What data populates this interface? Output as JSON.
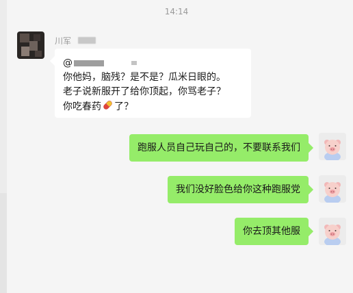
{
  "chat": {
    "timestamp": "14:14",
    "incoming": {
      "sender_name": "川军",
      "mention_prefix": "@",
      "lines": [
        "你他妈，脑残？是不是？瓜米日眼的。",
        "老子说新服开了给你顶起，你骂老子？",
        "你吃春药",
        "了？"
      ],
      "emoji": "pill-icon"
    },
    "outgoing": [
      {
        "text": "跑服人员自己玩自己的，不要联系我们"
      },
      {
        "text": "我们没好脸色给你这种跑服党"
      },
      {
        "text": "你去顶其他服"
      }
    ]
  },
  "colors": {
    "background": "#f5f5f5",
    "incoming_bubble": "#ffffff",
    "outgoing_bubble": "#95ec69",
    "timestamp": "#9a9a9a"
  }
}
